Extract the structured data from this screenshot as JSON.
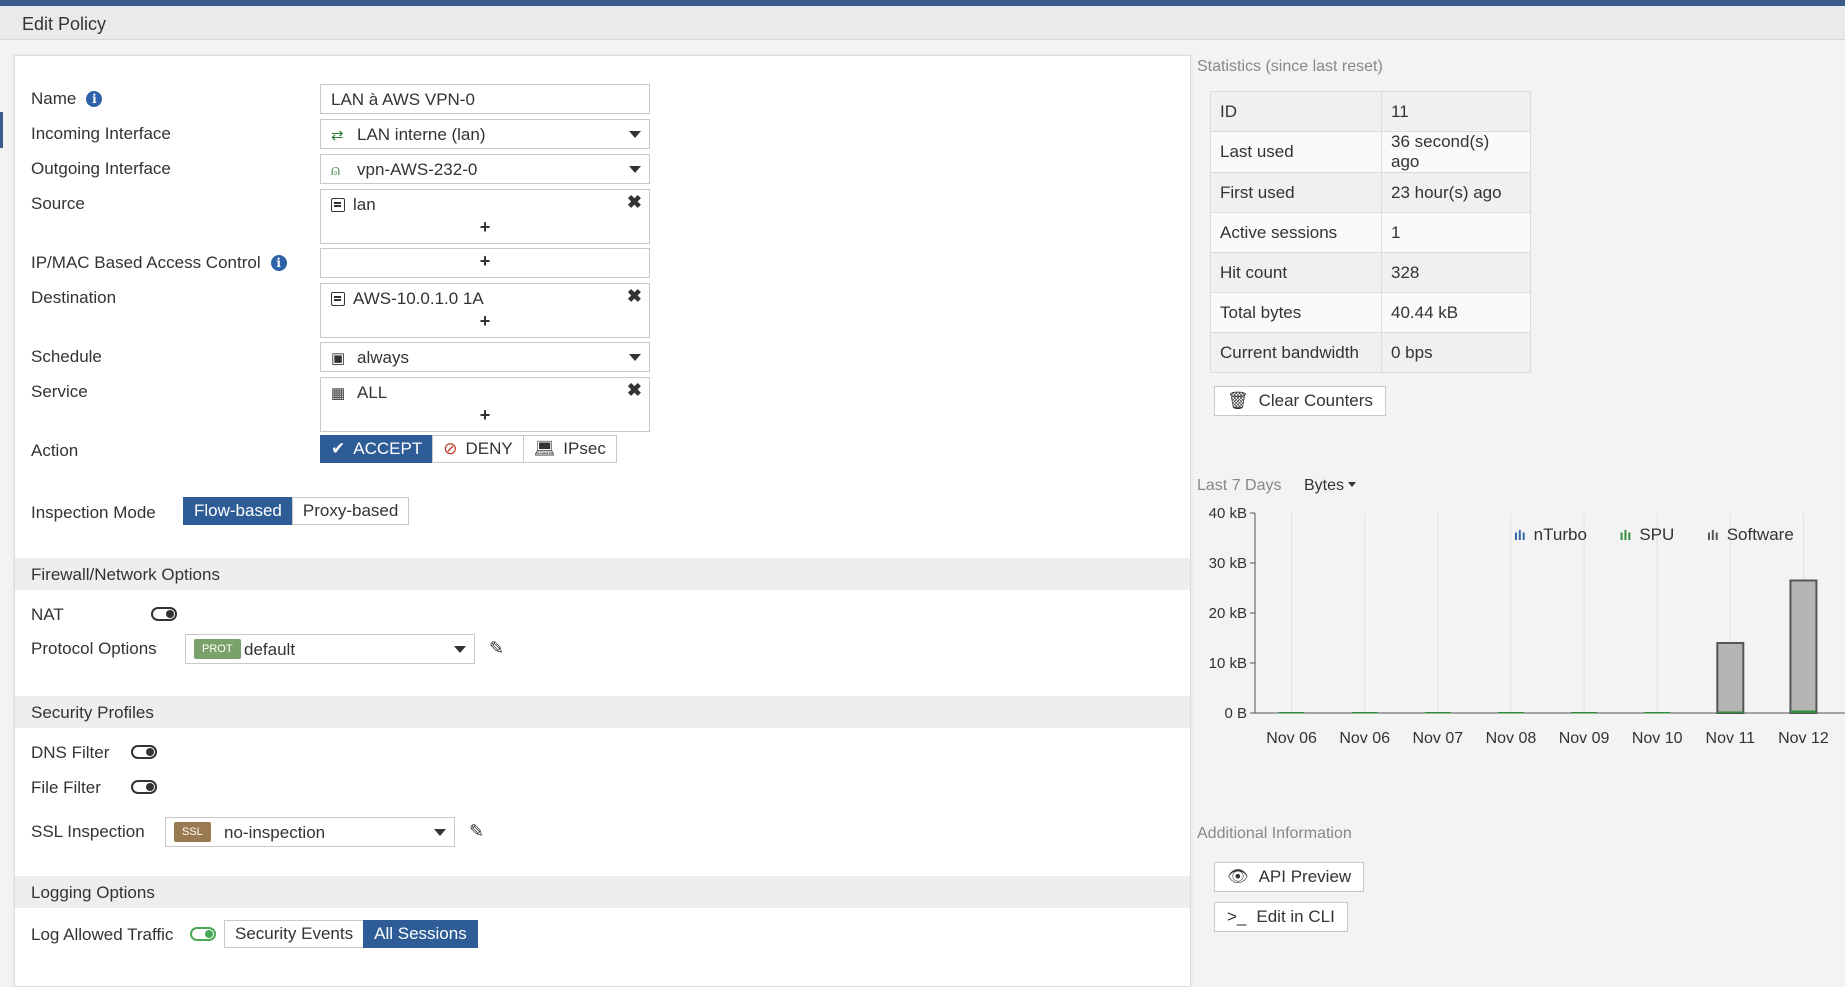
{
  "title": "Edit Policy",
  "form": {
    "name_label": "Name",
    "name_value": "LAN à AWS VPN-0",
    "incoming_label": "Incoming Interface",
    "incoming_value": "LAN interne (lan)",
    "outgoing_label": "Outgoing Interface",
    "outgoing_value": "vpn-AWS-232-0",
    "source_label": "Source",
    "source_value": "lan",
    "ipmac_label": "IP/MAC Based Access Control",
    "destination_label": "Destination",
    "destination_value": "AWS-10.0.1.0 1A",
    "schedule_label": "Schedule",
    "schedule_value": "always",
    "service_label": "Service",
    "service_value": "ALL",
    "action_label": "Action",
    "actions": [
      "ACCEPT",
      "DENY",
      "IPsec"
    ],
    "inspection_label": "Inspection Mode",
    "inspection_modes": [
      "Flow-based",
      "Proxy-based"
    ]
  },
  "firewall": {
    "header": "Firewall/Network Options",
    "nat_label": "NAT",
    "protocol_label": "Protocol Options",
    "protocol_tag": "PROT",
    "protocol_value": "default"
  },
  "security": {
    "header": "Security Profiles",
    "dns_label": "DNS Filter",
    "file_label": "File Filter",
    "ssl_label": "SSL Inspection",
    "ssl_tag": "SSL",
    "ssl_value": "no-inspection"
  },
  "logging": {
    "header": "Logging Options",
    "log_label": "Log Allowed Traffic",
    "modes": [
      "Security Events",
      "All Sessions"
    ]
  },
  "stats": {
    "title": "Statistics (since last reset)",
    "rows": [
      {
        "k": "ID",
        "v": "11"
      },
      {
        "k": "Last used",
        "v": "36 second(s) ago"
      },
      {
        "k": "First used",
        "v": "23 hour(s) ago"
      },
      {
        "k": "Active sessions",
        "v": "1"
      },
      {
        "k": "Hit count",
        "v": "328"
      },
      {
        "k": "Total bytes",
        "v": "40.44 kB"
      },
      {
        "k": "Current bandwidth",
        "v": "0 bps"
      }
    ],
    "clear_label": "Clear Counters"
  },
  "chart_controls": {
    "period": "Last 7 Days",
    "metric": "Bytes"
  },
  "chart_data": {
    "type": "bar",
    "categories": [
      "Nov 06",
      "Nov 06",
      "Nov 07",
      "Nov 08",
      "Nov 09",
      "Nov 10",
      "Nov 11",
      "Nov 12"
    ],
    "series": [
      {
        "name": "nTurbo",
        "values": [
          0,
          0,
          0,
          0,
          0,
          0,
          0,
          0
        ]
      },
      {
        "name": "SPU",
        "values": [
          0.2,
          0.2,
          0.2,
          0.2,
          0.2,
          0.2,
          0.3,
          0.5
        ]
      },
      {
        "name": "Software",
        "values": [
          0,
          0,
          0,
          0,
          0,
          0,
          14,
          26.5
        ]
      }
    ],
    "ytick_labels": [
      "0 B",
      "10 kB",
      "20 kB",
      "30 kB",
      "40 kB"
    ],
    "ylim": [
      0,
      40
    ],
    "grid": true,
    "legend_position": "top-right",
    "colors": {
      "nTurbo": "#2e62a8",
      "SPU": "#2f8a3a",
      "Software": "#555555",
      "software_bar": "#b5b5b5"
    }
  },
  "additional": {
    "title": "Additional Information",
    "api_label": "API Preview",
    "cli_label": "Edit in CLI"
  }
}
